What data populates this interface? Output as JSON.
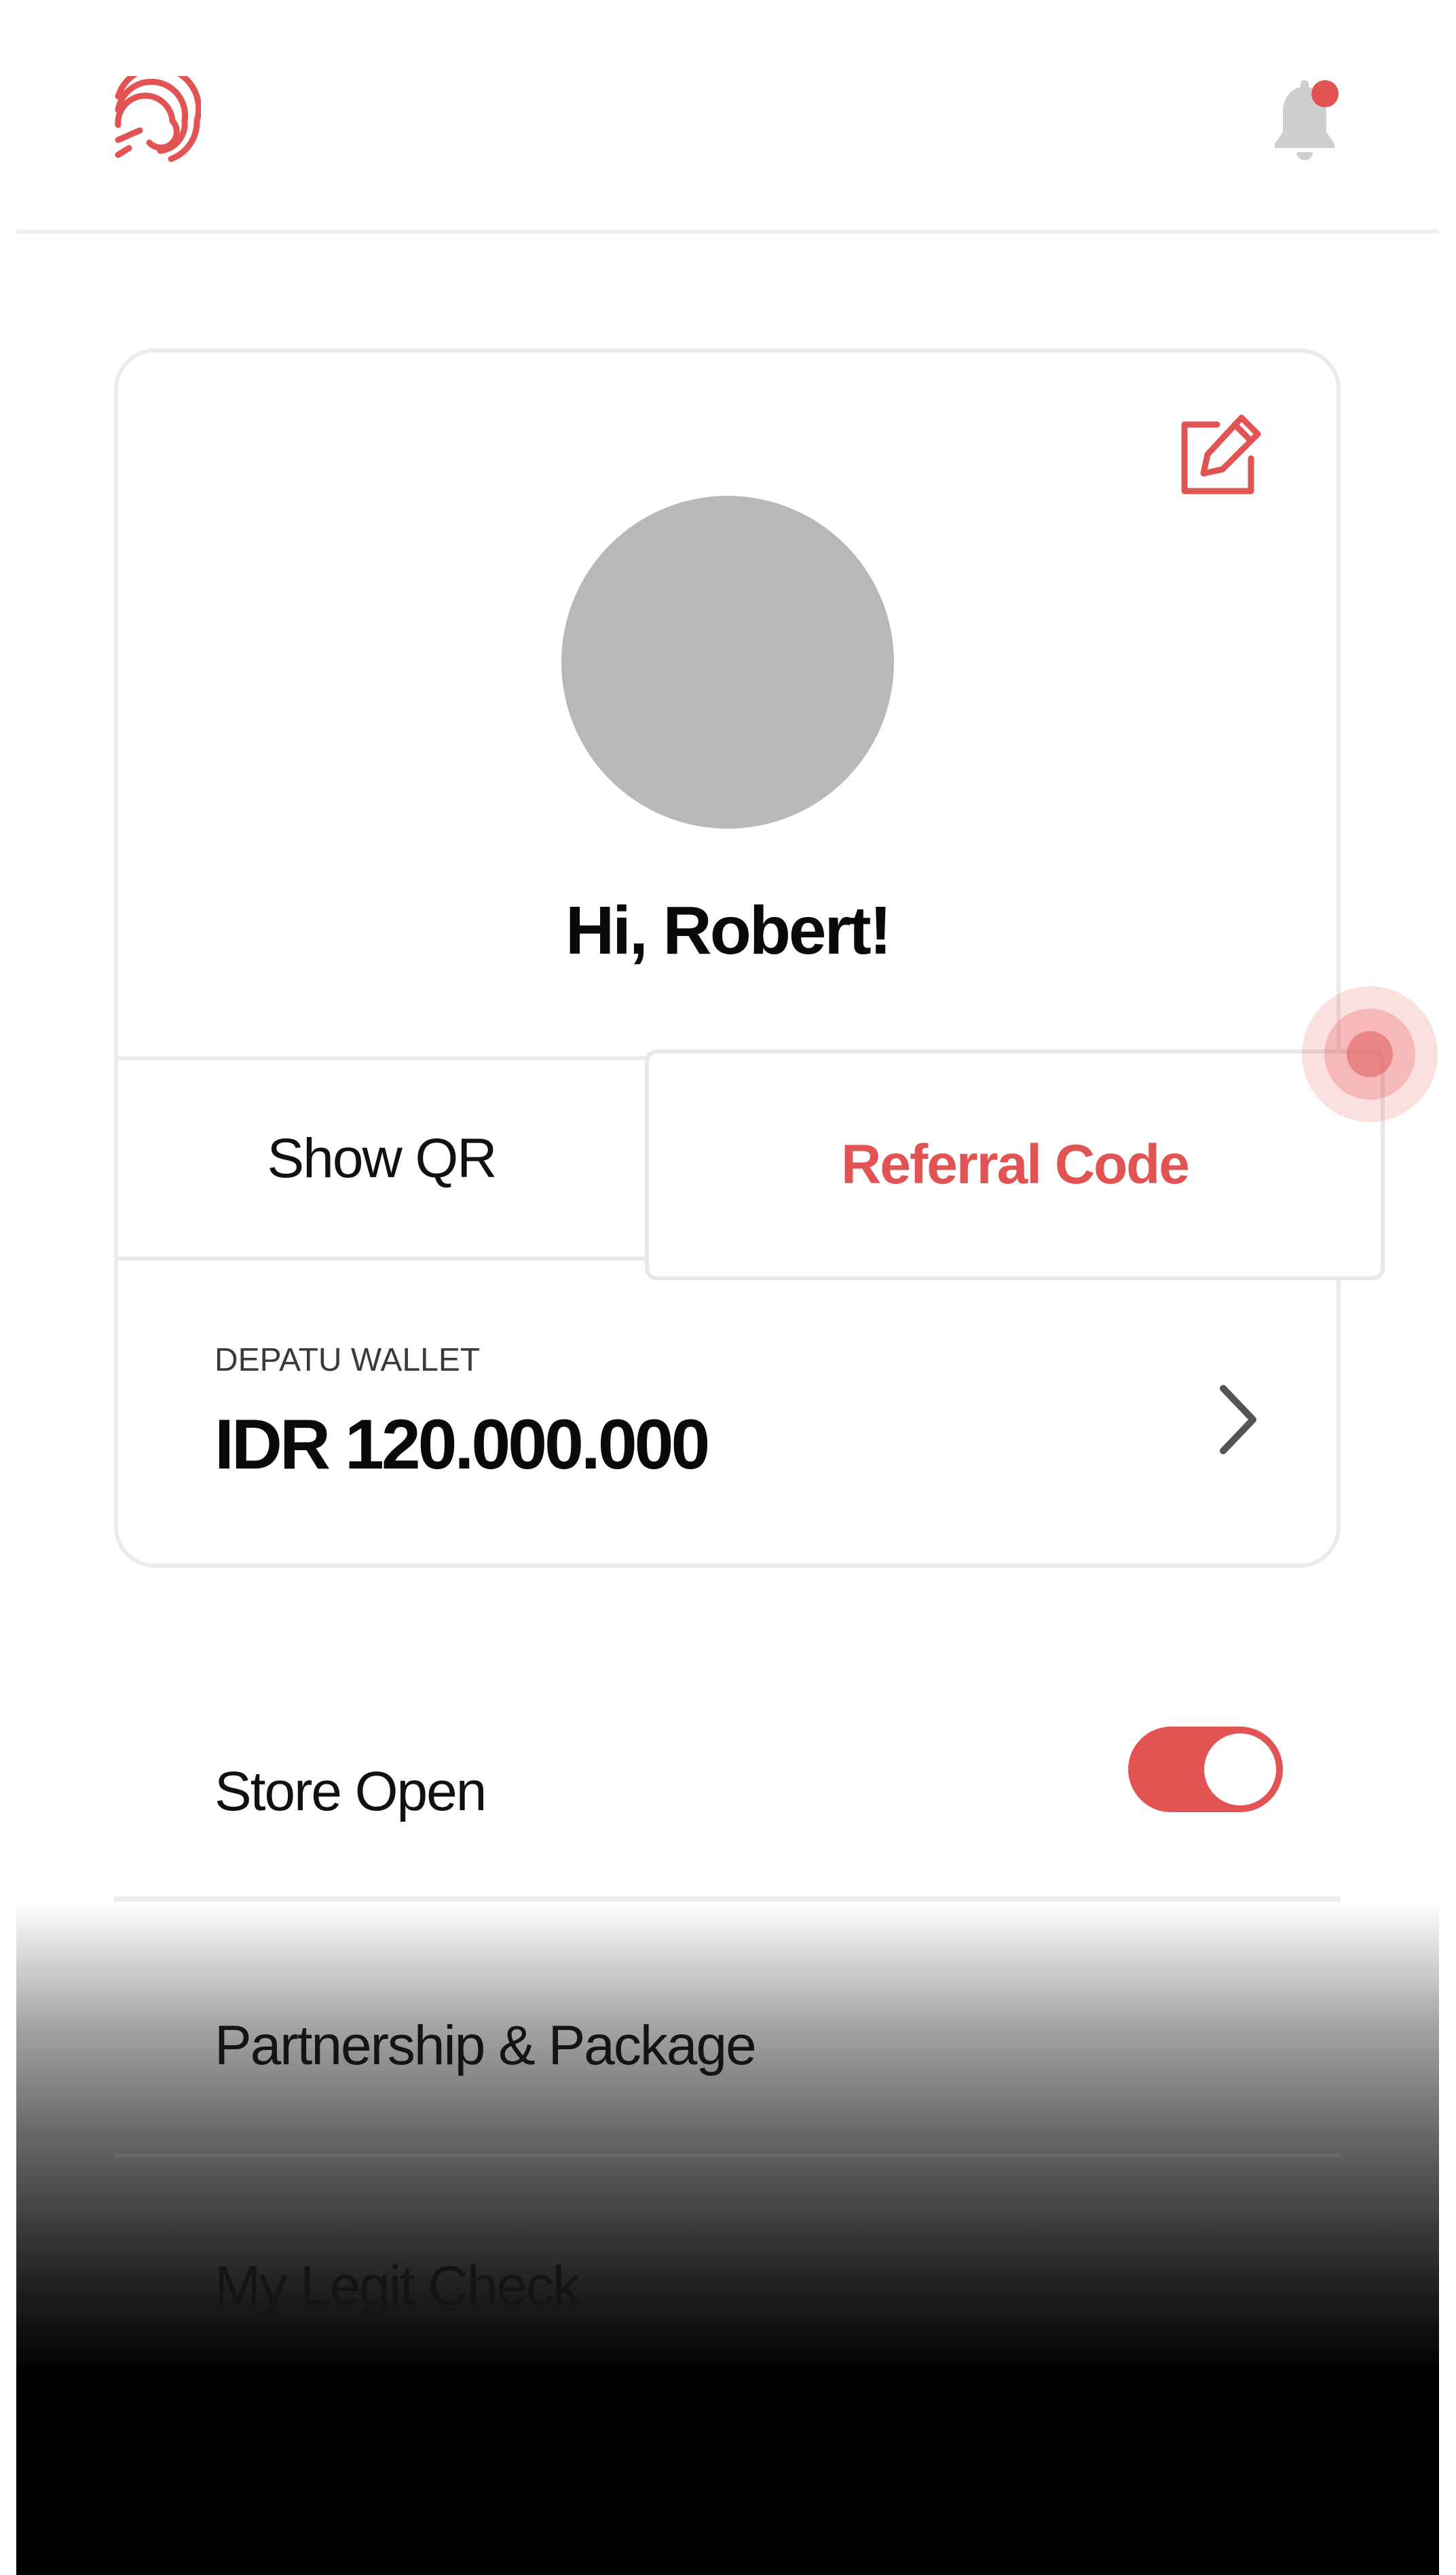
{
  "header": {
    "logo_icon": "depatu-fingerprint-logo-icon",
    "notification_icon": "bell-icon",
    "notification_badge": true
  },
  "profile": {
    "greeting": "Hi, Robert!",
    "edit_icon": "edit-icon",
    "show_qr_label": "Show QR",
    "referral_code_label": "Referral Code"
  },
  "wallet": {
    "label": "DEPATU WALLET",
    "amount": "IDR 120.000.000"
  },
  "menu": {
    "store_open_label": "Store Open",
    "store_open_enabled": true,
    "partnership_label": "Partnership & Package",
    "legit_check_label": "My Legit Check"
  },
  "colors": {
    "accent": "#e25353",
    "avatar_placeholder": "#b8b8b8",
    "icon_gray": "#cfcfcf"
  }
}
